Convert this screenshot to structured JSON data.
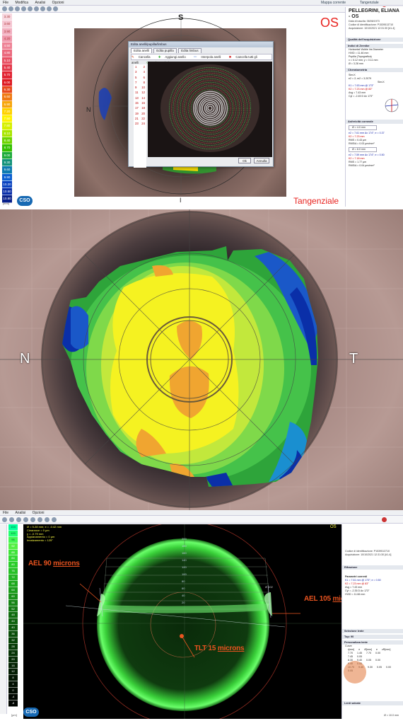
{
  "top": {
    "menu": [
      "File",
      "Modifica",
      "Analisi",
      "Opzioni"
    ],
    "header_right": [
      "Mappa corrente",
      "Tangenziale"
    ],
    "scale_labels": [
      "3.30",
      "3.60",
      "3.90",
      "4.20",
      "4.50",
      "4.80",
      "5.10",
      "5.40",
      "5.70",
      "6.00",
      "6.30",
      "6.60",
      "6.90",
      "7.20",
      "7.50",
      "7.80",
      "8.10",
      "8.40",
      "8.70",
      "9.00",
      "9.30",
      "9.60",
      "9.90",
      "10.20",
      "10.50",
      "10.80"
    ],
    "scale_colors": [
      "#f7d8e0",
      "#f5c6d2",
      "#f2b0c0",
      "#f09aad",
      "#ee8396",
      "#eb6a7e",
      "#e85265",
      "#e43a4c",
      "#e12534",
      "#de1a22",
      "#e84a1d",
      "#f07a14",
      "#f7a60c",
      "#ffd200",
      "#fff200",
      "#d6f000",
      "#a8e600",
      "#6ed400",
      "#35c000",
      "#1fab3c",
      "#13937a",
      "#0d7bb0",
      "#0a5fd0",
      "#0a43c0",
      "#0a2fa8",
      "#08208a"
    ],
    "unit": "[mm]",
    "logo": "CSO",
    "label_s": "S",
    "label_n": "N",
    "label_i": "I",
    "eye": "OS",
    "map_type": "Tangenziale",
    "dialog": {
      "title": "Edita anelli/pupilla/limbus",
      "tabs": [
        "Edita anelli",
        "Edita pupilla",
        "Edita limbus"
      ],
      "tools": [
        "Cancella",
        "Aggiungi anello",
        "Interpola anelli",
        "Cancella tutti gli anelli",
        "Ricostruisci"
      ],
      "rings": [
        [
          "1",
          "2"
        ],
        [
          "3",
          "4"
        ],
        [
          "5",
          "6"
        ],
        [
          "7",
          "8"
        ],
        [
          "9",
          "10"
        ],
        [
          "11",
          "12"
        ],
        [
          "13",
          "14"
        ],
        [
          "15",
          "16"
        ],
        [
          "17",
          "18"
        ],
        [
          "19",
          "20"
        ],
        [
          "21",
          "22"
        ],
        [
          "23",
          "24"
        ]
      ],
      "ok": "Ok",
      "cancel": "Annulla"
    },
    "panel": {
      "name": "PELLEGRINI, ELIANA - OS",
      "dob": "Data di nascita: 06/06/1973",
      "code": "Codice di identificazione: P1539513710",
      "acq": "Acquisizione: 10/10/2021 12:31:30 [#1-4]",
      "sec_quality": "Qualità dell'acquisizione",
      "sec_indices": "Indici di Zernike",
      "hvid": "Horizontal Visible Iris Diameter",
      "hvid_val": "HVID = 11.46 mm",
      "pupil": "Pupilla (Topografica)",
      "pupil_xy": "x = 0.12 mm; y = 0.11 mm",
      "pupil_d": "Ø = 3.28 mm",
      "sec_kerato": "Cheratometria",
      "sim_k": "Sim-K",
      "e2": "e2 = 2; m2 = 3.2079",
      "sim_k_right": "Sim-K",
      "k1": "K1 = 7.63 mm @ 173°",
      "k2": "K2 = 7.23 mm @ 83°",
      "avg": "Avg = 7.43 mm",
      "cyl": "Cyl = -2.45 D Ax 173°",
      "sec_asph": "Asfericità corneale",
      "asph1": "Ø = 4.0 mm",
      "asph1_e": "e2 = 7.61 mm Ax 174°; e = 0.37",
      "asph1_k": "K2 = 7.23 mm",
      "asph1_rms": "RMS = 0.43 μm",
      "asph1_rmsa": "RMS/A = 0.03 μm/mm²",
      "asph2": "Ø = 8.0 mm",
      "asph2_e": "e2 = 7.59 mm Ax 174°; e = 0.50",
      "asph2_k": "K2 = 7.18 mm",
      "asph2_rms": "RMS = 1.77 μm",
      "asph2_rmsa": "RMS/A = 0.04 μm/mm²"
    }
  },
  "mid": {
    "label_n": "N",
    "label_t": "T"
  },
  "bot": {
    "menu": [
      "File",
      "Analisi",
      "Opzioni"
    ],
    "params": [
      "Ø = 5.28 mm; e = -0.42 mm",
      "Clearance = 0 μm",
      "y = -0.79 mm",
      "Appianamento = 0 μm",
      "Innalzamento = 125°"
    ],
    "scale_labels": [
      "104",
      "100",
      "96",
      "92",
      "88",
      "84",
      "80",
      "76",
      "72",
      "68",
      "64",
      "60",
      "56",
      "52",
      "48",
      "44",
      "40",
      "36",
      "32",
      "28",
      "24",
      "20",
      "16",
      "12",
      "8",
      "4",
      "0",
      "-4",
      "-8"
    ],
    "scale_colors": [
      "#00ff9a",
      "#22ff70",
      "#44f750",
      "#55ef44",
      "#3fe43a",
      "#33d832",
      "#2bcd2b",
      "#26c026",
      "#22b422",
      "#1fa81f",
      "#1c9c1c",
      "#199019",
      "#168416",
      "#137813",
      "#106c10",
      "#0e620e",
      "#0c580c",
      "#0a4e0a",
      "#084408",
      "#073b07",
      "#063306",
      "#052b05",
      "#042404",
      "#031d03",
      "#021602",
      "#021002",
      "#010c01",
      "#010801",
      "#000500"
    ],
    "unit": "[μm]",
    "logo": "CSO",
    "eye": "OS",
    "ann_ael90": [
      "AEL 90 ",
      "microns"
    ],
    "ann_ael105": [
      "AEL 105 ",
      "microns"
    ],
    "ann_tlt": [
      "TLT 15 ",
      "microns"
    ],
    "profile_ticks": [
      "200",
      "180",
      "160",
      "140",
      "120",
      "100",
      "80",
      "60",
      "40",
      "20"
    ],
    "panel": {
      "code": "Codice di identificazione: P1539513710",
      "acq": "Acquisizione: 10/10/2021 12:31:30 [#1-4]",
      "sec_refr": "Rifrazione",
      "params_title": "Parametri correnti",
      "k1": "K1 = 7.61 mm @ 173°; e = 0.50",
      "k2": "K2 = 7.23 mm @ 83°",
      "avg": "Avg = 7.43 mm",
      "cyl": "Cyl = -2.35 D Ax 173°",
      "hvid": "HVID = 11.66 mm",
      "sec_sel": "Selezione lente",
      "sec_top": "Top: 90",
      "sec_pers": "Personalizza lente",
      "curve": "Curve",
      "cols": [
        "r[mm]",
        "e",
        "Ø[mm]",
        "e",
        "zR[mm]"
      ],
      "row1": [
        "7.70",
        "1.45",
        "7.70",
        "0.00"
      ],
      "row2": [
        "7.45",
        "0.05"
      ],
      "row3": [
        "8.30",
        "9.40",
        "0.05",
        "0.00"
      ],
      "row4": [
        "9.40",
        "0.05"
      ],
      "row5": [
        "10.70",
        "9.40",
        "9.30",
        "0.05",
        "0.00"
      ],
      "row6": [
        "0.05"
      ],
      "sec_saved": "Lenti salvate",
      "footer": "Ø = 10.0 mm"
    }
  }
}
